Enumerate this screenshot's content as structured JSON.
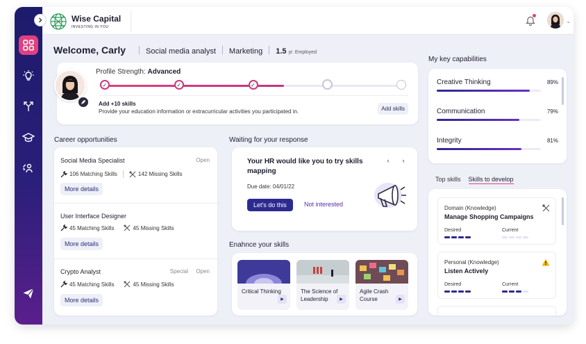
{
  "brand": {
    "name": "Wise Capital",
    "tagline": "INVESTING IN YOU"
  },
  "welcome": {
    "greeting": "Welcome, Carly",
    "role": "Social media analyst",
    "department": "Marketing",
    "tenure_value": "1.5",
    "tenure_unit": "yr. Employed"
  },
  "profile": {
    "strength_label": "Profile Strength:",
    "strength_value": "Advanced",
    "progress": 0.6,
    "steps": 5,
    "completed_steps": 3,
    "add_title": "Add +10 skills",
    "add_desc": "Provide your education information or extracurricular activities you participated in.",
    "add_button": "Add skills"
  },
  "career": {
    "title": "Career opportunities",
    "jobs": [
      {
        "title": "Social Media Specialist",
        "special": "",
        "status": "Open",
        "matching": "106 Matching Skills",
        "missing": "142 Missing Skills",
        "more": "More details"
      },
      {
        "title": "User Interface Designer",
        "special": "",
        "status": "",
        "matching": "45 Matching Skills",
        "missing": "45 Missing Skills",
        "more": "More details"
      },
      {
        "title": "Crypto Analyst",
        "special": "Special",
        "status": "Open",
        "matching": "45 Matching Skills",
        "missing": "45 Missing Skills",
        "more": "More details"
      }
    ]
  },
  "waiting": {
    "title": "Waiting for your response",
    "message": "Your HR would like you to try skills mapping",
    "due": "Due date: 04/01/22",
    "primary": "Let's do this",
    "secondary": "Not interested",
    "prev": "‹",
    "next": "›"
  },
  "enhance": {
    "title": "Enahnce your skills",
    "courses": [
      {
        "name": "Critical Thinking",
        "color": "#5a4fb8"
      },
      {
        "name": "The Science of Leadership",
        "color": "#b9c3c6"
      },
      {
        "name": "Agile Crash Course",
        "color": "#8a5a66"
      }
    ]
  },
  "capabilities": {
    "title": "My key capabilities",
    "items": [
      {
        "name": "Creative Thinking",
        "value": "89%",
        "level": 0.89
      },
      {
        "name": "Communication",
        "value": "79%",
        "level": 0.79
      },
      {
        "name": "Integrity",
        "value": "81%",
        "level": 0.81
      }
    ]
  },
  "tabs": {
    "top": "Top skills",
    "develop": "Skills to develop"
  },
  "develop": [
    {
      "category": "Domain (Knowledge)",
      "name": "Manage Shopping Campaigns",
      "desired": "Desired",
      "current": "Current",
      "desired_level": 4,
      "current_level": 0,
      "icon": "tools-icon"
    },
    {
      "category": "Personal (Knowledge)",
      "name": "Listen Actively",
      "desired": "Desired",
      "current": "Current",
      "desired_level": 4,
      "current_level": 3,
      "icon": "warning-icon"
    }
  ],
  "colors": {
    "accent": "#e0407f",
    "primary": "#2d2a8f",
    "sidebar": "#1d1b6b"
  }
}
